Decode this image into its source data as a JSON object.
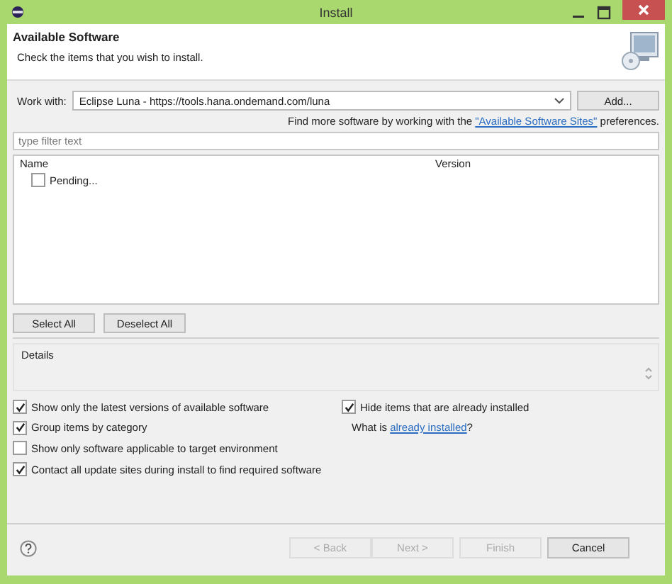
{
  "window": {
    "title": "Install"
  },
  "header": {
    "title": "Available Software",
    "subtitle": "Check the items that you wish to install."
  },
  "work_with": {
    "label": "Work with:",
    "value": "Eclipse Luna - https://tools.hana.ondemand.com/luna",
    "button": "Add..."
  },
  "sites_note": {
    "before": "Find more software by working with the ",
    "link": "\"Available Software Sites\"",
    "after": " preferences."
  },
  "filter": {
    "placeholder": "type filter text"
  },
  "table": {
    "columns": [
      "Name",
      "Version"
    ],
    "rows": [
      {
        "name": "Pending...",
        "checked": false
      }
    ]
  },
  "selection_buttons": [
    "Select All",
    "Deselect All"
  ],
  "details": {
    "label": "Details"
  },
  "options": [
    {
      "label": "Show only the latest versions of available software",
      "checked": true
    },
    {
      "label": "Group items by category",
      "checked": true
    },
    {
      "label": "Show only software applicable to target environment",
      "checked": false
    },
    {
      "label": "Contact all update sites during install to find required software",
      "checked": true
    }
  ],
  "hide_installed": {
    "label": "Hide items that are already installed",
    "checked": true
  },
  "installed_note": {
    "before": "What is ",
    "link": "already installed",
    "after": "?"
  },
  "footer_buttons": [
    {
      "label": "< Back",
      "disabled": true
    },
    {
      "label": "Next >",
      "disabled": true
    },
    {
      "label": "Finish",
      "disabled": true
    },
    {
      "label": "Cancel",
      "disabled": false
    }
  ]
}
